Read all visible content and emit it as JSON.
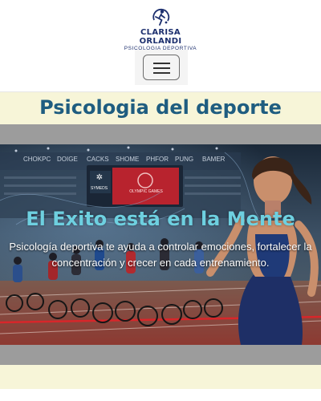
{
  "brand": {
    "name": "CLARISA ORLANDI",
    "subtitle": "PSICOLOGIA DEPORTIVA"
  },
  "nav": {
    "toggler_icon": "hamburger-icon"
  },
  "page": {
    "title": "Psicologia del deporte"
  },
  "hero": {
    "title": "El Exito está en la Mente",
    "text": "Psicología deportiva te ayuda a controlar emociones, fortalecer la concentración y crecer en cada entrenamiento.",
    "banner_labels": [
      "CHOKPC",
      "DOIGE",
      "CACKS",
      "SHOME",
      "PHFOR",
      "PUNG",
      "BAMER"
    ],
    "screen_text": "OLYMPIC GAMES",
    "sign_text": "SYMEDS"
  },
  "colors": {
    "title": "#1f5d80",
    "hero_title": "#6ed0e0",
    "band": "#f7f5d8",
    "brand": "#1c2f6e"
  }
}
